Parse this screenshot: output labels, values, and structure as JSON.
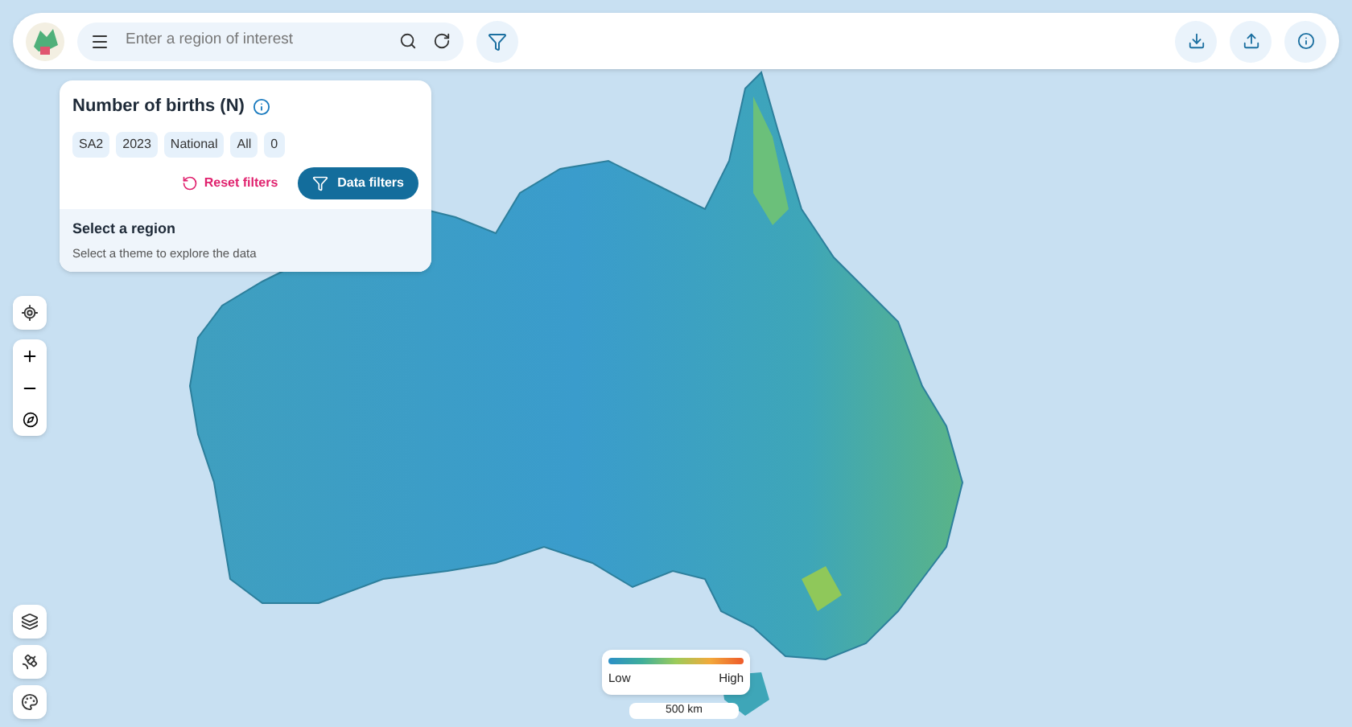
{
  "search": {
    "placeholder": "Enter a region of interest"
  },
  "panel": {
    "title": "Number of births (N)",
    "chips": [
      "SA2",
      "2023",
      "National",
      "All",
      "0"
    ],
    "reset_label": "Reset filters",
    "filters_label": "Data filters",
    "section_title": "Select a region",
    "section_hint": "Select a theme to explore the data"
  },
  "legend": {
    "low": "Low",
    "high": "High"
  },
  "scale": "500 km"
}
